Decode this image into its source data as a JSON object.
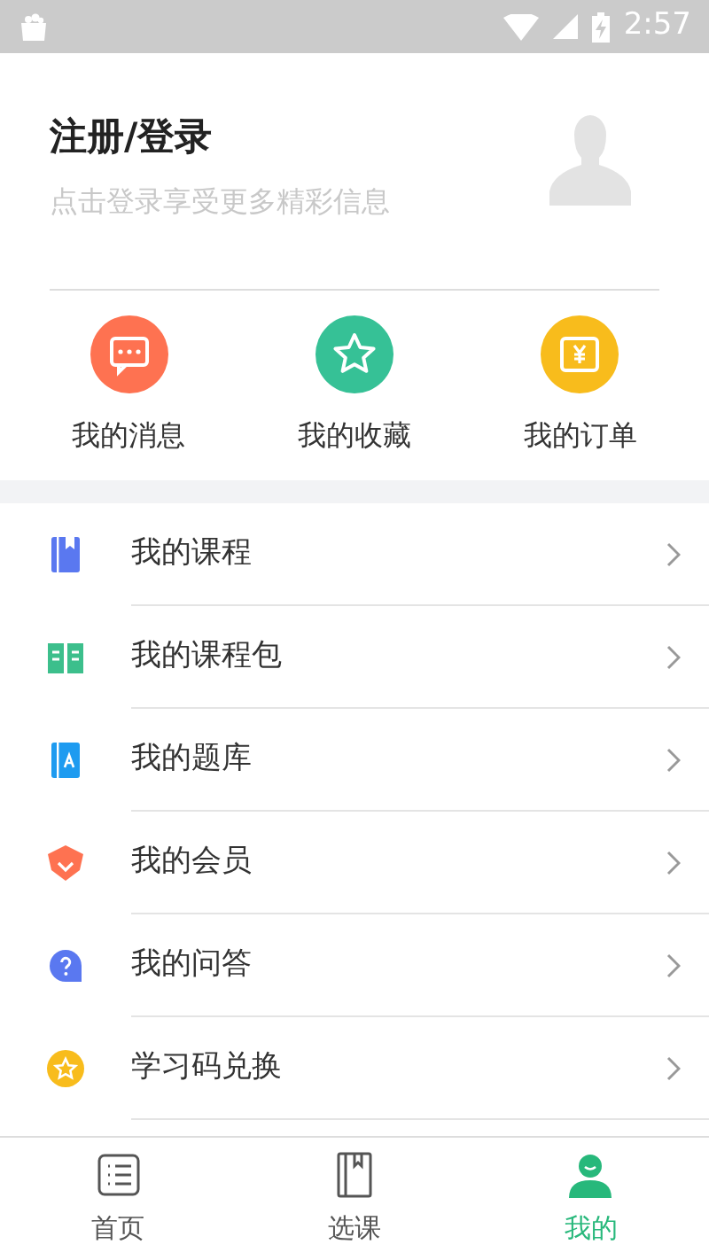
{
  "status_bar": {
    "time": "2:57"
  },
  "profile": {
    "title": "注册/登录",
    "subtitle": "点击登录享受更多精彩信息"
  },
  "shortcuts": [
    {
      "label": "我的消息",
      "kind": "message",
      "color": "#fe7251"
    },
    {
      "label": "我的收藏",
      "kind": "star",
      "color": "#36c196"
    },
    {
      "label": "我的订单",
      "kind": "order",
      "color": "#f8bc1c"
    }
  ],
  "menu": [
    {
      "label": "我的课程",
      "kind": "course"
    },
    {
      "label": "我的课程包",
      "kind": "package"
    },
    {
      "label": "我的题库",
      "kind": "bank"
    },
    {
      "label": "我的会员",
      "kind": "member"
    },
    {
      "label": "我的问答",
      "kind": "qa"
    },
    {
      "label": "学习码兑换",
      "kind": "code"
    }
  ],
  "tab_bar": [
    {
      "label": "首页",
      "kind": "home",
      "selected": false
    },
    {
      "label": "选课",
      "kind": "courses",
      "selected": false
    },
    {
      "label": "我的",
      "kind": "me",
      "selected": true
    }
  ]
}
